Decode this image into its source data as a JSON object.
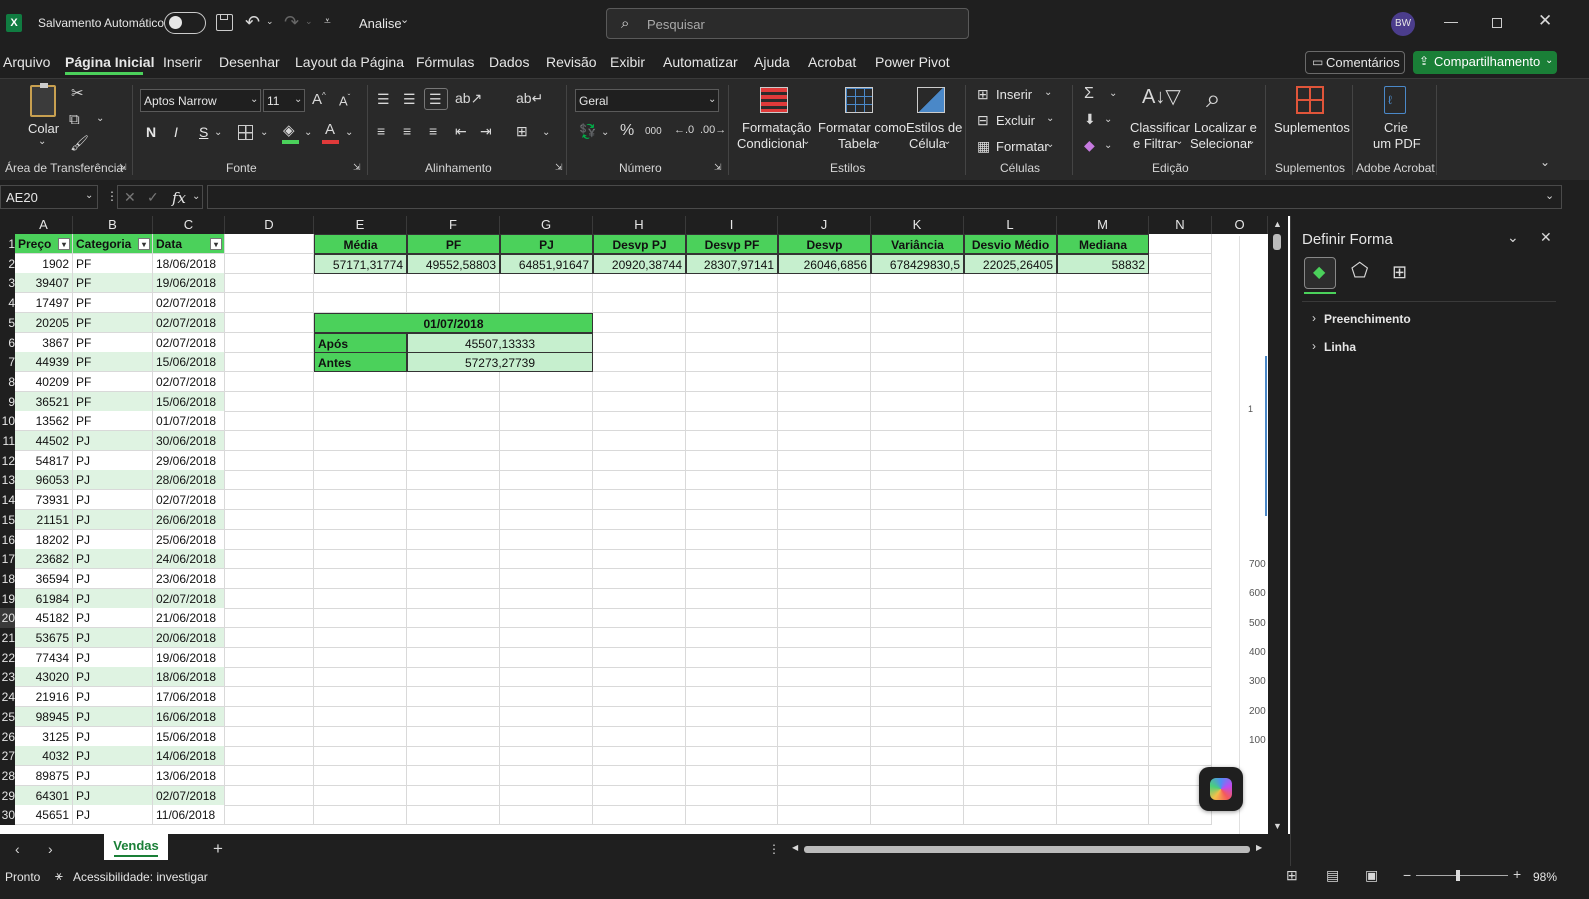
{
  "titlebar": {
    "autosave_label": "Salvamento Automático",
    "file_name": "Analise",
    "search_placeholder": "Pesquisar",
    "user_initials": "BW"
  },
  "ribbon_tabs": [
    "Arquivo",
    "Página Inicial",
    "Inserir",
    "Desenhar",
    "Layout da Página",
    "Fórmulas",
    "Dados",
    "Revisão",
    "Exibir",
    "Automatizar",
    "Ajuda",
    "Acrobat",
    "Power Pivot"
  ],
  "active_tab": "Página Inicial",
  "comments_label": "Comentários",
  "share_label": "Compartilhamento",
  "ribbon": {
    "paste_label": "Colar",
    "clipboard_group": "Área de Transferência",
    "font_name": "Aptos Narrow",
    "font_size": "11",
    "font_group": "Fonte",
    "bold": "N",
    "italic": "I",
    "underline": "S",
    "align_group": "Alinhamento",
    "number_format": "Geral",
    "number_group": "Número",
    "cond_format": [
      "Formatação",
      "Condicional"
    ],
    "format_table": [
      "Formatar como",
      "Tabela"
    ],
    "cell_styles": [
      "Estilos de",
      "Célula"
    ],
    "styles_group": "Estilos",
    "insert_label": "Inserir",
    "delete_label": "Excluir",
    "format_label": "Formatar",
    "cells_group": "Células",
    "sort_filter": [
      "Classificar",
      "e Filtrar"
    ],
    "find_select": [
      "Localizar e",
      "Selecionar"
    ],
    "editing_group": "Edição",
    "addins_label": "Suplementos",
    "addins_group": "Suplementos",
    "create_pdf": [
      "Crie",
      "um PDF"
    ],
    "acrobat_group": "Adobe Acrobat"
  },
  "formula_bar": {
    "name_box": "AE20",
    "fx": "fx",
    "formula": ""
  },
  "columns": [
    "A",
    "B",
    "C",
    "D",
    "E",
    "F",
    "G",
    "H",
    "I",
    "J",
    "K",
    "L",
    "M",
    "N",
    "O"
  ],
  "table_headers": [
    "Preço",
    "Categoria",
    "Data"
  ],
  "rows": [
    [
      "1902",
      "PF",
      "18/06/2018"
    ],
    [
      "39407",
      "PF",
      "19/06/2018"
    ],
    [
      "17497",
      "PF",
      "02/07/2018"
    ],
    [
      "20205",
      "PF",
      "02/07/2018"
    ],
    [
      "3867",
      "PF",
      "02/07/2018"
    ],
    [
      "44939",
      "PF",
      "15/06/2018"
    ],
    [
      "40209",
      "PF",
      "02/07/2018"
    ],
    [
      "36521",
      "PF",
      "15/06/2018"
    ],
    [
      "13562",
      "PF",
      "01/07/2018"
    ],
    [
      "44502",
      "PJ",
      "30/06/2018"
    ],
    [
      "54817",
      "PJ",
      "29/06/2018"
    ],
    [
      "96053",
      "PJ",
      "28/06/2018"
    ],
    [
      "73931",
      "PJ",
      "02/07/2018"
    ],
    [
      "21151",
      "PJ",
      "26/06/2018"
    ],
    [
      "18202",
      "PJ",
      "25/06/2018"
    ],
    [
      "23682",
      "PJ",
      "24/06/2018"
    ],
    [
      "36594",
      "PJ",
      "23/06/2018"
    ],
    [
      "61984",
      "PJ",
      "02/07/2018"
    ],
    [
      "45182",
      "PJ",
      "21/06/2018"
    ],
    [
      "53675",
      "PJ",
      "20/06/2018"
    ],
    [
      "77434",
      "PJ",
      "19/06/2018"
    ],
    [
      "43020",
      "PJ",
      "18/06/2018"
    ],
    [
      "21916",
      "PJ",
      "17/06/2018"
    ],
    [
      "98945",
      "PJ",
      "16/06/2018"
    ],
    [
      "3125",
      "PJ",
      "15/06/2018"
    ],
    [
      "4032",
      "PJ",
      "14/06/2018"
    ],
    [
      "89875",
      "PJ",
      "13/06/2018"
    ],
    [
      "64301",
      "PJ",
      "02/07/2018"
    ],
    [
      "45651",
      "PJ",
      "11/06/2018"
    ]
  ],
  "row_numbers": [
    "1",
    "2",
    "3",
    "4",
    "5",
    "6",
    "7",
    "8",
    "9",
    "10",
    "11",
    "12",
    "13",
    "14",
    "15",
    "16",
    "17",
    "18",
    "19",
    "20",
    "21",
    "22",
    "23",
    "24",
    "25",
    "26",
    "27",
    "28",
    "29",
    "30"
  ],
  "stats": {
    "headers": [
      "Média",
      "PF",
      "PJ",
      "Desvp  PJ",
      "Desvp  PF",
      "Desvp",
      "Variância",
      "Desvio Médio",
      "Mediana"
    ],
    "values": [
      "57171,31774",
      "49552,58803",
      "64851,91647",
      "20920,38744",
      "28307,97141",
      "26046,6856",
      "678429830,5",
      "22025,26405",
      "58832"
    ]
  },
  "date_block": {
    "title": "01/07/2018",
    "rows": [
      [
        "Após",
        "45507,13333"
      ],
      [
        "Antes",
        "57273,27739"
      ]
    ]
  },
  "chart_fragment": {
    "label_1": "1",
    "y_ticks": [
      "700",
      "600",
      "500",
      "400",
      "300",
      "200",
      "100"
    ]
  },
  "sheet_tab": "Vendas",
  "status_text": "Pronto",
  "accessibility": "Acessibilidade: investigar",
  "zoom": "98%",
  "format_pane": {
    "title": "Definir Forma",
    "sections": [
      "Preenchimento",
      "Linha"
    ]
  },
  "colors": {
    "accent_green": "#4bd15b",
    "light_green": "#c6efce",
    "share_button": "#1a7f37"
  }
}
